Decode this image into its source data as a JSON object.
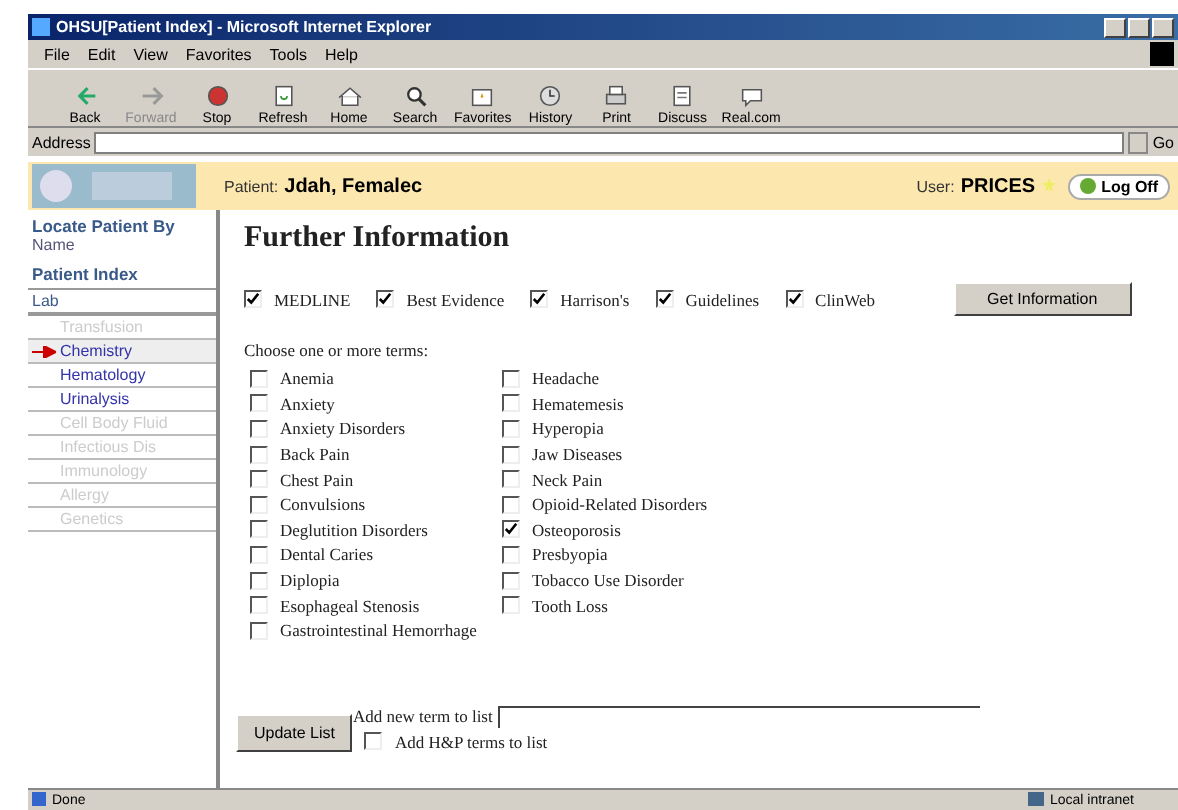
{
  "window": {
    "title": "OHSU[Patient Index] - Microsoft Internet Explorer"
  },
  "menu": [
    "File",
    "Edit",
    "View",
    "Favorites",
    "Tools",
    "Help"
  ],
  "toolbar": [
    {
      "label": "Back",
      "disabled": false
    },
    {
      "label": "Forward",
      "disabled": true
    },
    {
      "label": "Stop",
      "disabled": false
    },
    {
      "label": "Refresh",
      "disabled": false
    },
    {
      "label": "Home",
      "disabled": false
    },
    {
      "label": "Search",
      "disabled": false
    },
    {
      "label": "Favorites",
      "disabled": false
    },
    {
      "label": "History",
      "disabled": false
    },
    {
      "label": "Print",
      "disabled": false
    },
    {
      "label": "Discuss",
      "disabled": false
    },
    {
      "label": "Real.com",
      "disabled": false
    }
  ],
  "address": {
    "label": "Address",
    "go": "Go"
  },
  "header": {
    "patient_label": "Patient:",
    "patient_name": "Jdah, Femalec",
    "user_label": "User:",
    "user_name": "PRICES",
    "logoff": "Log Off"
  },
  "sidebar": {
    "locate_title": "Locate Patient By",
    "locate_item": "Name",
    "index_title": "Patient Index",
    "section": "Lab",
    "items": [
      {
        "label": "Transfusion",
        "selected": false,
        "disabled": true
      },
      {
        "label": "Chemistry",
        "selected": true,
        "disabled": false
      },
      {
        "label": "Hematology",
        "selected": false,
        "disabled": false
      },
      {
        "label": "Urinalysis",
        "selected": false,
        "disabled": false
      },
      {
        "label": "Cell Body Fluid",
        "selected": false,
        "disabled": true
      },
      {
        "label": "Infectious Dis",
        "selected": false,
        "disabled": true
      },
      {
        "label": "Immunology",
        "selected": false,
        "disabled": true
      },
      {
        "label": "Allergy",
        "selected": false,
        "disabled": true
      },
      {
        "label": "Genetics",
        "selected": false,
        "disabled": true
      }
    ]
  },
  "content": {
    "heading": "Further Information",
    "sources": [
      {
        "label": "MEDLINE",
        "checked": true
      },
      {
        "label": "Best Evidence",
        "checked": true
      },
      {
        "label": "Harrison's",
        "checked": true
      },
      {
        "label": "Guidelines",
        "checked": true
      },
      {
        "label": "ClinWeb",
        "checked": true
      }
    ],
    "get_button": "Get Information",
    "terms_prompt": "Choose one or more terms:",
    "terms_columns": [
      [
        {
          "label": "Anemia",
          "checked": false
        },
        {
          "label": "Anxiety",
          "checked": false
        },
        {
          "label": "Anxiety Disorders",
          "checked": false
        },
        {
          "label": "Back Pain",
          "checked": false
        },
        {
          "label": "Chest Pain",
          "checked": false
        },
        {
          "label": "Convulsions",
          "checked": false
        },
        {
          "label": "Deglutition Disorders",
          "checked": false
        },
        {
          "label": "Dental Caries",
          "checked": false
        },
        {
          "label": "Diplopia",
          "checked": false
        },
        {
          "label": "Esophageal Stenosis",
          "checked": false
        },
        {
          "label": "Gastrointestinal Hemorrhage",
          "checked": false
        }
      ],
      [
        {
          "label": "Headache",
          "checked": false
        },
        {
          "label": "Hematemesis",
          "checked": false
        },
        {
          "label": "Hyperopia",
          "checked": false
        },
        {
          "label": "Jaw Diseases",
          "checked": false
        },
        {
          "label": "Neck Pain",
          "checked": false
        },
        {
          "label": "Opioid-Related Disorders",
          "checked": false
        },
        {
          "label": "Osteoporosis",
          "checked": true
        },
        {
          "label": "Presbyopia",
          "checked": false
        },
        {
          "label": "Tobacco Use Disorder",
          "checked": false
        },
        {
          "label": "Tooth Loss",
          "checked": false
        }
      ]
    ],
    "update_button": "Update List",
    "add_term_label": "Add new term to list",
    "add_hp": {
      "label": "Add H&P terms to list",
      "checked": false
    }
  },
  "status_bar": {
    "text": "Done",
    "zone": "Local intranet"
  }
}
